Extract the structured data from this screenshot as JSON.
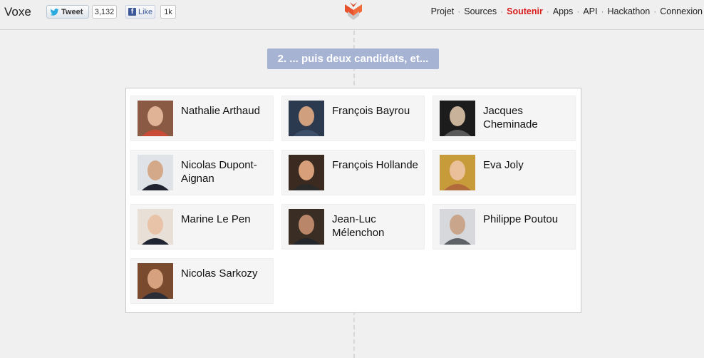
{
  "topbar": {
    "brand": "Voxe",
    "tweet_label": "Tweet",
    "tweet_count": "3,132",
    "fb_label": "Like",
    "fb_count": "1k",
    "nav": [
      {
        "label": "Projet",
        "active": false
      },
      {
        "label": "Sources",
        "active": false
      },
      {
        "label": "Soutenir",
        "active": true
      },
      {
        "label": "Apps",
        "active": false
      },
      {
        "label": "API",
        "active": false
      },
      {
        "label": "Hackathon",
        "active": false
      },
      {
        "label": "Connexion",
        "active": false
      }
    ],
    "nav_separator": "·"
  },
  "step": {
    "label": "2. ... puis deux candidats, et..."
  },
  "candidates": [
    {
      "name": "Nathalie Arthaud",
      "photo": "portrait-photo"
    },
    {
      "name": "François Bayrou",
      "photo": "portrait-photo"
    },
    {
      "name": "Jacques Cheminade",
      "photo": "portrait-photo"
    },
    {
      "name": "Nicolas Dupont-Aignan",
      "photo": "portrait-photo"
    },
    {
      "name": "François Hollande",
      "photo": "portrait-photo"
    },
    {
      "name": "Eva Joly",
      "photo": "portrait-photo"
    },
    {
      "name": "Marine Le Pen",
      "photo": "portrait-photo"
    },
    {
      "name": "Jean-Luc Mélenchon",
      "photo": "portrait-photo"
    },
    {
      "name": "Philippe Poutou",
      "photo": "portrait-photo"
    },
    {
      "name": "Nicolas Sarkozy",
      "photo": "portrait-photo"
    }
  ],
  "colors": {
    "accent_active_nav": "#d81c1c",
    "step_bg": "#a6b3d3",
    "logo_orange": "#e8522d"
  }
}
